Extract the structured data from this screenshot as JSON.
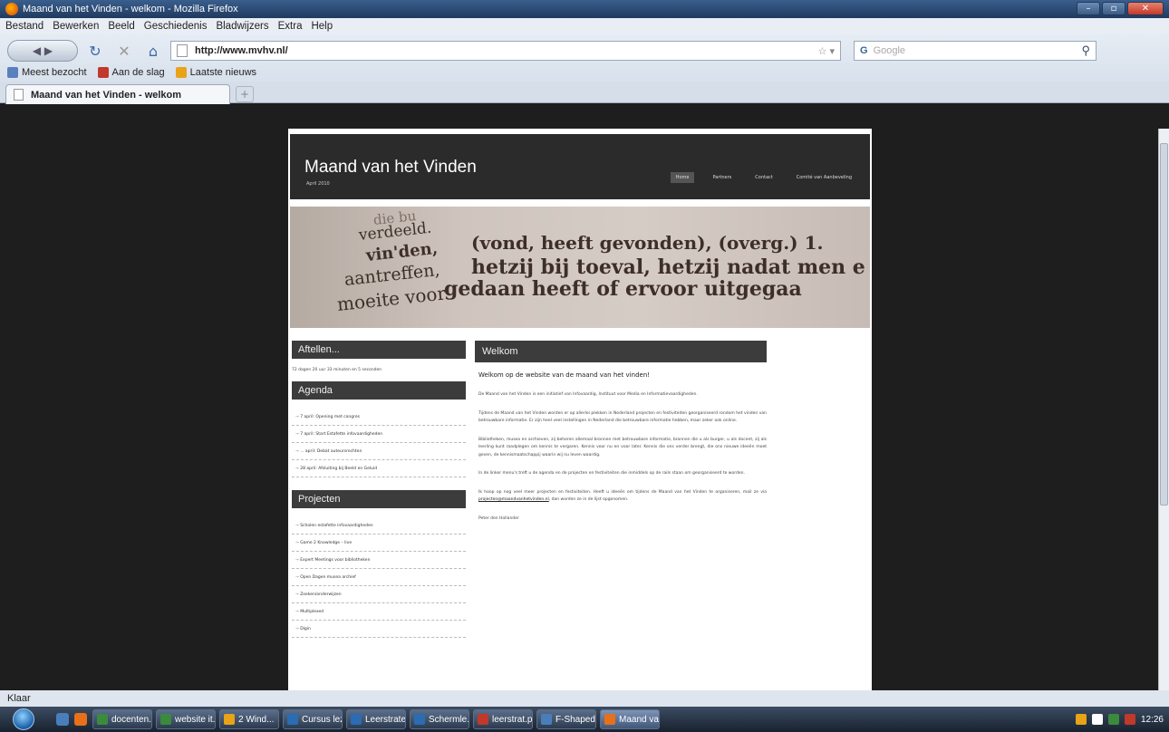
{
  "window": {
    "title": "Maand van het Vinden - welkom - Mozilla Firefox",
    "controls": [
      "–",
      "▫",
      "✕"
    ]
  },
  "menu": [
    "Bestand",
    "Bewerken",
    "Beeld",
    "Geschiedenis",
    "Bladwijzers",
    "Extra",
    "Help"
  ],
  "nav": {
    "url": "http://www.mvhv.nl/",
    "search_placeholder": "Google",
    "search_engine": "G"
  },
  "bookmarks": [
    {
      "label": "Meest bezocht",
      "color": "#5a7fbf"
    },
    {
      "label": "Aan de slag",
      "color": "#c0392b"
    },
    {
      "label": "Laatste nieuws",
      "color": "#e8a317"
    }
  ],
  "tab": {
    "label": "Maand van het Vinden - welkom",
    "new_tab": "+"
  },
  "site": {
    "title": "Maand van het Vinden",
    "subtitle": "April 2010",
    "nav": [
      "Home",
      "Partners",
      "Contact",
      "Comité van Aanbeveling"
    ],
    "nav_active": "Home",
    "banner": {
      "line1": "die bu",
      "line2": "verdeeld.",
      "line3": "vin'den,",
      "line3b": "(vond, heeft gevonden), (overg.) 1.",
      "line4": "aantreffen,",
      "line4b": "hetzij bij toeval, hetzij nadat men e",
      "line5": "moeite voor",
      "line5b": "gedaan heeft of ervoor uitgegaa"
    },
    "sidebar": {
      "countdown_title": "Aftellen...",
      "countdown_text": "72 dagen 20 uur 33 minuten en 5 seconden",
      "agenda_title": "Agenda",
      "agenda": [
        "7 april: Opening met congres",
        "7 april: Start Estafette infovaardigheden",
        "... april: Debat auteursrechten",
        "28 april: Afsluiting bij Beeld en Geluid"
      ],
      "projects_title": "Projecten",
      "projects": [
        "Scholen estafette infovaardigheden",
        "Game 2 Knowledge – live",
        "Expert Meetings voor bibliotheken",
        "Open Dagen musea archief",
        "Zoeken/onderwijzen",
        "Multiplexed",
        "Digin"
      ]
    },
    "main": {
      "header": "Welkom",
      "heading": "Welkom op de website van de maand van het vinden!",
      "paragraphs": [
        "De Maand van het Vinden is een initiatief van Infovaardig, Instituut voor Media en Informatievaardigheden.",
        "Tijdens de Maand van het Vinden worden er op allerlei plekken in Nederland projecten en festiviteiten georganiseerd rondom het vinden van betrouwbare informatie. Er zijn heel veel instellingen in Nederland die betrouwbare informatie hebben, maar zeker ook online.",
        "Bibliotheken, musea en archieven, zij beheren allemaal bronnen met betrouwbare informatie, bronnen die u als burger, u als docent, zij als leerling kunt raadplegen om kennis te vergaren. Kennis voor nu en voor later. Kennis die ons verder brengt, die ons nieuwe ideeën moet geven, de kennismaatschappij waarin wij nu leven waardig.",
        "In de linker menu's treft u de agenda en de projecten en festiviteiten die inmiddels op de rails staan om georganiseerd te worden.",
        "Ik hoop op nog veel meer projecten en festiviteiten. Heeft u ideeën om tijdens de Maand van het Vinden te organiseren, mail ze via",
        "Peter den Hollander"
      ],
      "email": "projecten@maandvanhetvinden.nl",
      "paragraph5_tail": ", dan worden ze in de lijst opgenomen."
    }
  },
  "status": "Klaar",
  "taskbar": {
    "items": [
      {
        "label": "docenten...",
        "color": "#3b8a3e"
      },
      {
        "label": "website it...",
        "color": "#3b8a3e"
      },
      {
        "label": "2 Wind...",
        "color": "#e8a317"
      },
      {
        "label": "Cursus lez...",
        "color": "#2b6cb3"
      },
      {
        "label": "Leerstrate...",
        "color": "#2b6cb3"
      },
      {
        "label": "Schermle...",
        "color": "#2b6cb3"
      },
      {
        "label": "leerstrat.p...",
        "color": "#c0392b"
      },
      {
        "label": "F-Shaped ...",
        "color": "#4a7ebb"
      },
      {
        "label": "Maand va...",
        "color": "#e8701a"
      }
    ],
    "active": "Maand va...",
    "clock": "12:26"
  }
}
